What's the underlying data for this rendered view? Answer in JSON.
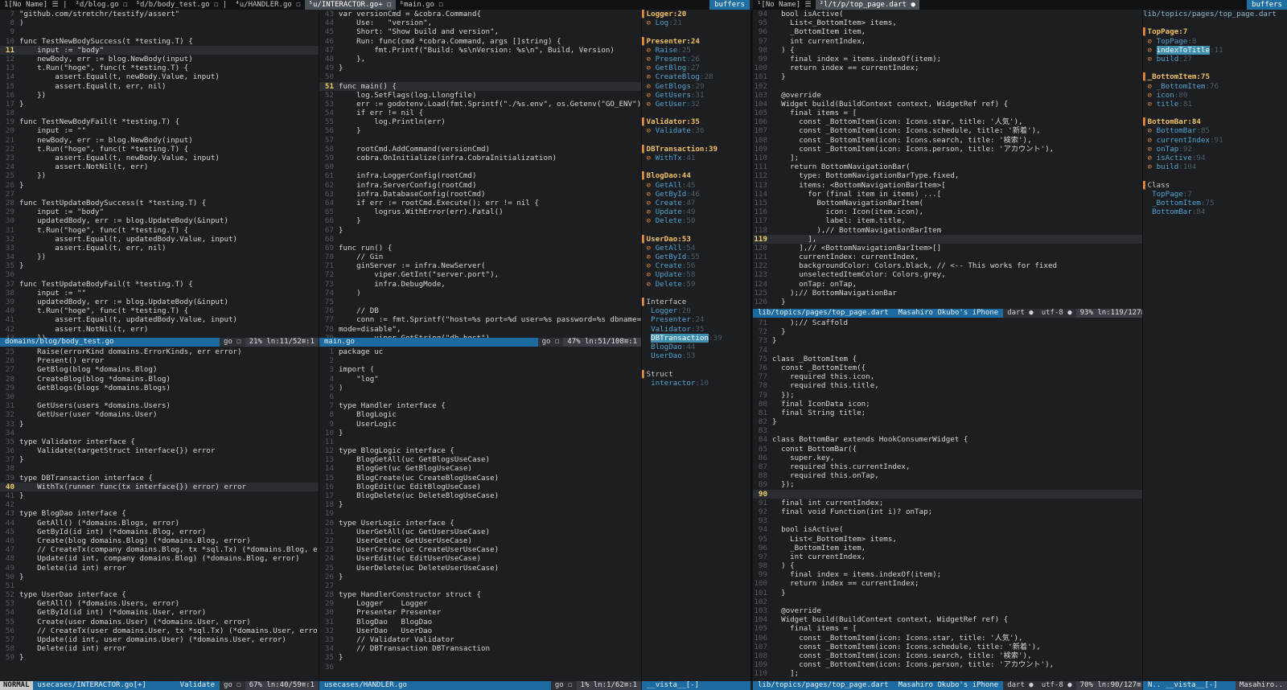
{
  "colors": {
    "accent": "#1d6aa0",
    "keyword": "#d94fd0",
    "string": "#e8d06a",
    "type": "#c060e0",
    "comment": "#6a6f75"
  },
  "tabline_left": {
    "tabs": [
      "1[No Name] ☰ |",
      "²d/blog.go ☐",
      "³d/b/body_test.go ☐ |",
      "⁴u/HANDLER.go ☐",
      "⁵u/INTERACTOR.go+ ☐",
      "⁶main.go ☐"
    ],
    "selected": 4,
    "buffers": "buffers"
  },
  "tabline_right": {
    "tabs": [
      "¹[No Name] ☰",
      "²l/t/p/top_page.dart ●"
    ],
    "selected": 1,
    "buffers": "buffers"
  },
  "panes": {
    "body_test": {
      "start": 7,
      "current": 11,
      "lines": [
        "\"github.com/stretchr/testify/assert\"",
        ")",
        "",
        "func TestNewBodySuccess(t *testing.T) {",
        "    input := \"body\"",
        "    newBody, err := blog.NewBody(input)",
        "    t.Run(\"hoge\", func(t *testing.T) {",
        "        assert.Equal(t, newBody.Value, input)",
        "        assert.Equal(t, err, nil)",
        "    })",
        "}",
        "",
        "func TestNewBodyFail(t *testing.T) {",
        "    input := \"\"",
        "    newBody, err := blog.NewBody(input)",
        "    t.Run(\"hoge\", func(t *testing.T) {",
        "        assert.Equal(t, newBody.Value, input)",
        "        assert.NotNil(t, err)",
        "    })",
        "}",
        "",
        "func TestUpdateBodySuccess(t *testing.T) {",
        "    input := \"body\"",
        "    updatedBody, err := blog.UpdateBody(&input)",
        "    t.Run(\"hoge\", func(t *testing.T) {",
        "        assert.Equal(t, updatedBody.Value, input)",
        "        assert.Equal(t, err, nil)",
        "    })",
        "}",
        "",
        "func TestUpdateBodyFail(t *testing.T) {",
        "    input := \"\"",
        "    updatedBody, err := blog.UpdateBody(&input)",
        "    t.Run(\"hoge\", func(t *testing.T) {",
        "        assert.Equal(t, updatedBody.Value, input)",
        "        assert.NotNil(t, err)",
        "    })"
      ],
      "status": {
        "file": "domains/blog/body_test.go",
        "ft": "go ☐",
        "pos": "21% ln:11/52≡:1"
      }
    },
    "main_top": {
      "start": 43,
      "current": 51,
      "lines": [
        "var versionCmd = &cobra.Command{",
        "    Use:   \"version\",",
        "    Short: \"Show build and version\",",
        "    Run: func(cmd *cobra.Command, args []string) {",
        "        fmt.Printf(\"Build: %s\\nVersion: %s\\n\", Build, Version)",
        "    },",
        "}",
        "",
        "func main() {",
        "    log.SetFlags(log.Llongfile)",
        "    err := godotenv.Load(fmt.Sprintf(\"./%s.env\", os.Getenv(\"GO_ENV\")))",
        "    if err != nil {",
        "        log.Println(err)",
        "    }",
        "",
        "    rootCmd.AddCommand(versionCmd)",
        "    cobra.OnInitialize(infra.CobraInitialization)",
        "",
        "    infra.LoggerConfig(rootCmd)",
        "    infra.ServerConfig(rootCmd)",
        "    infra.DatabaseConfig(rootCmd)",
        "    if err := rootCmd.Execute(); err != nil {",
        "        logrus.WithError(err).Fatal()",
        "    }",
        "}",
        "",
        "func run() {",
        "    // Gin",
        "    ginServer := infra.NewServer(",
        "        viper.GetInt(\"server.port\"),",
        "        infra.DebugMode,",
        "    )",
        "",
        "    // DB",
        "    conn := fmt.Sprintf(\"host=%s port=%d user=%s password=%s dbname=%s ssl",
        "mode=disable\",",
        "        viper.GetString(\"db.host\"),"
      ],
      "status": {
        "file": "main.go",
        "ft": "go ☐",
        "pos": "47% ln:51/108≡:1"
      }
    },
    "interactor": {
      "start": 25,
      "current": 40,
      "lines": [
        "    Raise(errorKind domains.ErrorKinds, err error)",
        "    Present() error",
        "    GetBlog(blog *domains.Blog)",
        "    CreateBlog(blog *domains.Blog)",
        "    GetBlogs(blogs *domains.Blogs)",
        "",
        "    GetUsers(users *domains.Users)",
        "    GetUser(user *domains.User)",
        "}",
        "",
        "type Validator interface {",
        "    Validate(targetStruct interface{}) error",
        "}",
        "",
        "type DBTransaction interface {",
        "    WithTx(runner func(tx interface{}) error) error",
        "}",
        "",
        "type BlogDao interface {",
        "    GetAll() (*domains.Blogs, error)",
        "    GetById(id int) (*domains.Blog, error)",
        "    Create(blog domains.Blog) (*domains.Blog, error)",
        "    // CreateTx(company domains.Blog, tx *sql.Tx) (*domains.Blog, error)",
        "    Update(id int, company domains.Blog) (*domains.Blog, error)",
        "    Delete(id int) error",
        "}",
        "",
        "type UserDao interface {",
        "    GetAll() (*domains.Users, error)",
        "    GetById(id int) (*domains.User, error)",
        "    Create(user domains.User) (*domains.User, error)",
        "    // CreateTx(user domains.User, tx *sql.Tx) (*domains.User, error)",
        "    Update(id int, user domains.User) (*domains.User, error)",
        "    Delete(id int) error",
        "}"
      ],
      "status": {
        "mode": "NORMAL",
        "file": "usecases/INTERACTOR.go[+]",
        "fn": "Validate",
        "ft": "go ☐",
        "pos": "67% ln:40/59≡:1"
      }
    },
    "handler": {
      "start": 1,
      "current": 0,
      "lines": [
        "package uc",
        "",
        "import (",
        "    \"log\"",
        ")",
        "",
        "type Handler interface {",
        "    BlogLogic",
        "    UserLogic",
        "}",
        "",
        "type BlogLogic interface {",
        "    BlogGetAll(uc GetBlogsUseCase)",
        "    BlogGet(uc GetBlogUseCase)",
        "    BlogCreate(uc CreateBlogUseCase)",
        "    BlogEdit(uc EditBlogUseCase)",
        "    BlogDelete(uc DeleteBlogUseCase)",
        "}",
        "",
        "type UserLogic interface {",
        "    UserGetAll(uc GetUsersUseCase)",
        "    UserGet(uc GetUserUseCase)",
        "    UserCreate(uc CreateUserUseCase)",
        "    UserEdit(uc EditUserUseCase)",
        "    UserDelete(uc DeleteUserUseCase)",
        "}",
        "",
        "type HandlerConstructor struct {",
        "    Logger    Logger",
        "    Presenter Presenter",
        "    BlogDao   BlogDao",
        "    UserDao   UserDao",
        "    // Validator Validator",
        "    // DBTransaction DBTransaction",
        "}",
        ""
      ],
      "status": {
        "file": "usecases/HANDLER.go",
        "ft": "go ☐",
        "pos": "1% ln:1/62≡:1"
      }
    },
    "dart_top": {
      "start": 94,
      "current": 119,
      "lines": [
        "  bool isActive(",
        "    List<_BottomItem> items,",
        "    _BottomItem item,",
        "    int currentIndex,",
        "  ) {",
        "    final index = items.indexOf(item);",
        "    return index == currentIndex;",
        "  }",
        "",
        "  @override",
        "  Widget build(BuildContext context, WidgetRef ref) {",
        "    final items = [",
        "      const _BottomItem(icon: Icons.star, title: '人気'),",
        "      const _BottomItem(icon: Icons.schedule, title: '新着'),",
        "      const _BottomItem(icon: Icons.search, title: '検索'),",
        "      const _BottomItem(icon: Icons.person, title: 'アカウント'),",
        "    ];",
        "    return BottomNavigationBar(",
        "      type: BottomNavigationBarType.fixed,",
        "      items: <BottomNavigationBarItem>[",
        "        for (final item in items) ...[",
        "          BottomNavigationBarItem(",
        "            icon: Icon(item.icon),",
        "            label: item.title,",
        "          ),// BottomNavigationBarItem",
        "        ],",
        "      ],// <BottomNavigationBarItem>[]",
        "      currentIndex: currentIndex,",
        "      backgroundColor: Colors.black, // <-- This works for fixed",
        "      unselectedItemColor: Colors.grey,",
        "      onTap: onTap,",
        "    );// BottomNavigationBar",
        "  }"
      ],
      "status": {
        "file": "lib/topics/pages/top_page.dart",
        "dev": "Masahiro Okubo's iPhone",
        "ft": "dart ●",
        "enc": "utf-8 ●",
        "pos": "93% ln:119/127≡:1"
      }
    },
    "dart_bottom": {
      "start": 71,
      "current": 90,
      "lines": [
        "    );// Scaffold",
        "  }",
        "}",
        "",
        "class _BottomItem {",
        "  const _BottomItem({",
        "    required this.icon,",
        "    required this.title,",
        "  });",
        "  final IconData icon;",
        "  final String title;",
        "}",
        "",
        "class BottomBar extends HookConsumerWidget {",
        "  const BottomBar({",
        "    super.key,",
        "    required this.currentIndex,",
        "    required this.onTap,",
        "  });",
        "",
        "  final int currentIndex;",
        "  final void Function(int i)? onTap;",
        "",
        "  bool isActive(",
        "    List<_BottomItem> items,",
        "    _BottomItem item,",
        "    int currentIndex,",
        "  ) {",
        "    final index = items.indexOf(item);",
        "    return index == currentIndex;",
        "  }",
        "",
        "  @override",
        "  Widget build(BuildContext context, WidgetRef ref) {",
        "    final items = [",
        "      const _BottomItem(icon: Icons.star, title: '人気'),",
        "      const _BottomItem(icon: Icons.schedule, title: '新着'),",
        "      const _BottomItem(icon: Icons.search, title: '検索'),",
        "      const _BottomItem(icon: Icons.person, title: 'アカウント'),",
        "    ];"
      ],
      "status": {
        "file": "lib/topics/pages/top_page.dart",
        "dev": "Masahiro Okubo's iPhone",
        "ft": "dart ●",
        "enc": "utf-8 ●",
        "pos": "70% ln:90/127≡:1",
        "vista": "N.. __vista__[-]",
        "user": "Masahiro.."
      }
    }
  },
  "vista_go": {
    "rows": [
      {
        "k": "head",
        "t": "Logger:20"
      },
      {
        "k": "item",
        "t": "Log",
        "n": ":21"
      },
      {
        "k": "blank",
        "t": ""
      },
      {
        "k": "head",
        "t": "Presenter:24"
      },
      {
        "k": "item",
        "t": "Raise",
        "n": ":25"
      },
      {
        "k": "item",
        "t": "Present",
        "n": ":26"
      },
      {
        "k": "item",
        "t": "GetBlog",
        "n": ":27"
      },
      {
        "k": "item",
        "t": "CreateBlog",
        "n": ":28"
      },
      {
        "k": "item",
        "t": "GetBlogs",
        "n": ":29"
      },
      {
        "k": "item",
        "t": "GetUsers",
        "n": ":31"
      },
      {
        "k": "item",
        "t": "GetUser",
        "n": ":32"
      },
      {
        "k": "blank",
        "t": ""
      },
      {
        "k": "head",
        "t": "Validator:35"
      },
      {
        "k": "item",
        "t": "Validate",
        "n": ":36"
      },
      {
        "k": "blank",
        "t": ""
      },
      {
        "k": "head",
        "t": "DBTransaction:39"
      },
      {
        "k": "item",
        "t": "WithTx",
        "n": ":41"
      },
      {
        "k": "blank",
        "t": ""
      },
      {
        "k": "head",
        "t": "BlogDao:44"
      },
      {
        "k": "item",
        "t": "GetAll",
        "n": ":45"
      },
      {
        "k": "item",
        "t": "GetById",
        "n": ":46"
      },
      {
        "k": "item",
        "t": "Create",
        "n": ":47"
      },
      {
        "k": "item",
        "t": "Update",
        "n": ":49"
      },
      {
        "k": "item",
        "t": "Delete",
        "n": ":50"
      },
      {
        "k": "blank",
        "t": ""
      },
      {
        "k": "head",
        "t": "UserDao:53"
      },
      {
        "k": "item",
        "t": "GetAll",
        "n": ":54"
      },
      {
        "k": "item",
        "t": "GetById",
        "n": ":55"
      },
      {
        "k": "item",
        "t": "Create",
        "n": ":56"
      },
      {
        "k": "item",
        "t": "Update",
        "n": ":58"
      },
      {
        "k": "item",
        "t": "Delete",
        "n": ":59"
      },
      {
        "k": "blank",
        "t": ""
      },
      {
        "k": "kind",
        "t": "Interface"
      },
      {
        "k": "sub",
        "t": "Logger",
        "n": ":20"
      },
      {
        "k": "sub",
        "t": "Presenter",
        "n": ":24"
      },
      {
        "k": "sub",
        "t": "Validator",
        "n": ":35"
      },
      {
        "k": "subsel",
        "t": "DBTransaction",
        "n": ":39"
      },
      {
        "k": "sub",
        "t": "BlogDao",
        "n": ":44"
      },
      {
        "k": "sub",
        "t": "UserDao",
        "n": ":53"
      },
      {
        "k": "blank",
        "t": ""
      },
      {
        "k": "kind",
        "t": "Struct"
      },
      {
        "k": "sub",
        "t": "interactor",
        "n": ":10"
      }
    ],
    "status": "__vista__[-]"
  },
  "vista_dart": {
    "title": "lib/topics/pages/top_page.dart",
    "rows": [
      {
        "k": "blank",
        "t": ""
      },
      {
        "k": "head",
        "t": "TopPage:7"
      },
      {
        "k": "item",
        "t": "TopPage",
        "n": ":8"
      },
      {
        "k": "itemsel",
        "t": "indexToTitle",
        "n": ":11"
      },
      {
        "k": "item",
        "t": "build",
        "n": ":27"
      },
      {
        "k": "blank",
        "t": ""
      },
      {
        "k": "head",
        "t": "_BottomItem:75"
      },
      {
        "k": "item",
        "t": "_BottomItem",
        "n": ":76"
      },
      {
        "k": "item",
        "t": "icon",
        "n": ":80"
      },
      {
        "k": "item",
        "t": "title",
        "n": ":81"
      },
      {
        "k": "blank",
        "t": ""
      },
      {
        "k": "head",
        "t": "BottomBar:84"
      },
      {
        "k": "item",
        "t": "BottomBar",
        "n": ":85"
      },
      {
        "k": "item",
        "t": "currentIndex",
        "n": ":91"
      },
      {
        "k": "item",
        "t": "onTap",
        "n": ":92"
      },
      {
        "k": "item",
        "t": "isActive",
        "n": ":94"
      },
      {
        "k": "item",
        "t": "build",
        "n": ":104"
      },
      {
        "k": "blank",
        "t": ""
      },
      {
        "k": "kind",
        "t": "Class"
      },
      {
        "k": "sub",
        "t": "TopPage",
        "n": ":7"
      },
      {
        "k": "sub",
        "t": "_BottomItem",
        "n": ":75"
      },
      {
        "k": "sub",
        "t": "BottomBar",
        "n": ":84"
      }
    ]
  }
}
